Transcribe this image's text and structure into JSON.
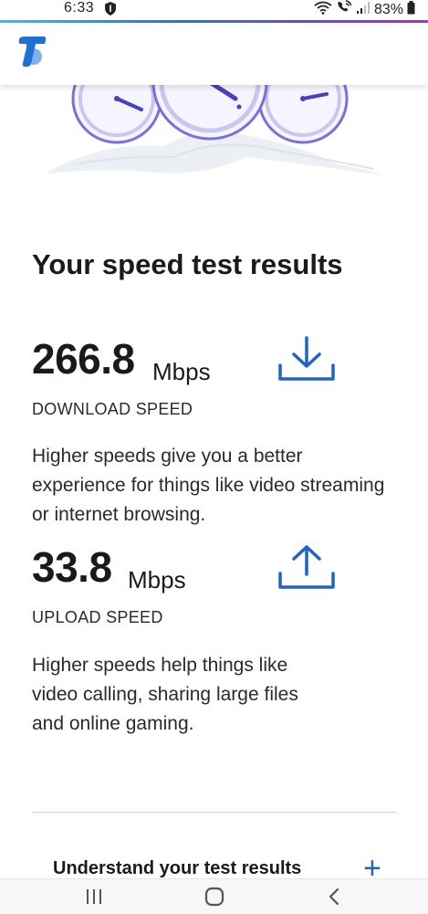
{
  "status_bar": {
    "time": "6:33",
    "battery_percent": "83%",
    "icons": [
      "shield-icon",
      "wifi-icon",
      "wifi-calling-icon",
      "signal-icon",
      "battery-icon"
    ]
  },
  "brand": {
    "logo": "telstra-logo-icon",
    "accent_color": "#1f63c6",
    "logo_color": "#1f6fd8"
  },
  "results": {
    "title": "Your speed test results",
    "download": {
      "value": "266.8",
      "unit": "Mbps",
      "label": "DOWNLOAD SPEED",
      "description": "Higher speeds give you a better experience for things like video streaming or internet browsing.",
      "icon": "download-icon"
    },
    "upload": {
      "value": "33.8",
      "unit": "Mbps",
      "label": "UPLOAD SPEED",
      "description": "Higher speeds help things like video calling, sharing large files and online gaming.",
      "icon": "upload-icon"
    }
  },
  "accordion": {
    "title": "Understand your test results",
    "icon": "plus-icon"
  },
  "nav_bar": {
    "buttons": [
      "recent-apps-icon",
      "home-icon",
      "back-icon"
    ]
  }
}
